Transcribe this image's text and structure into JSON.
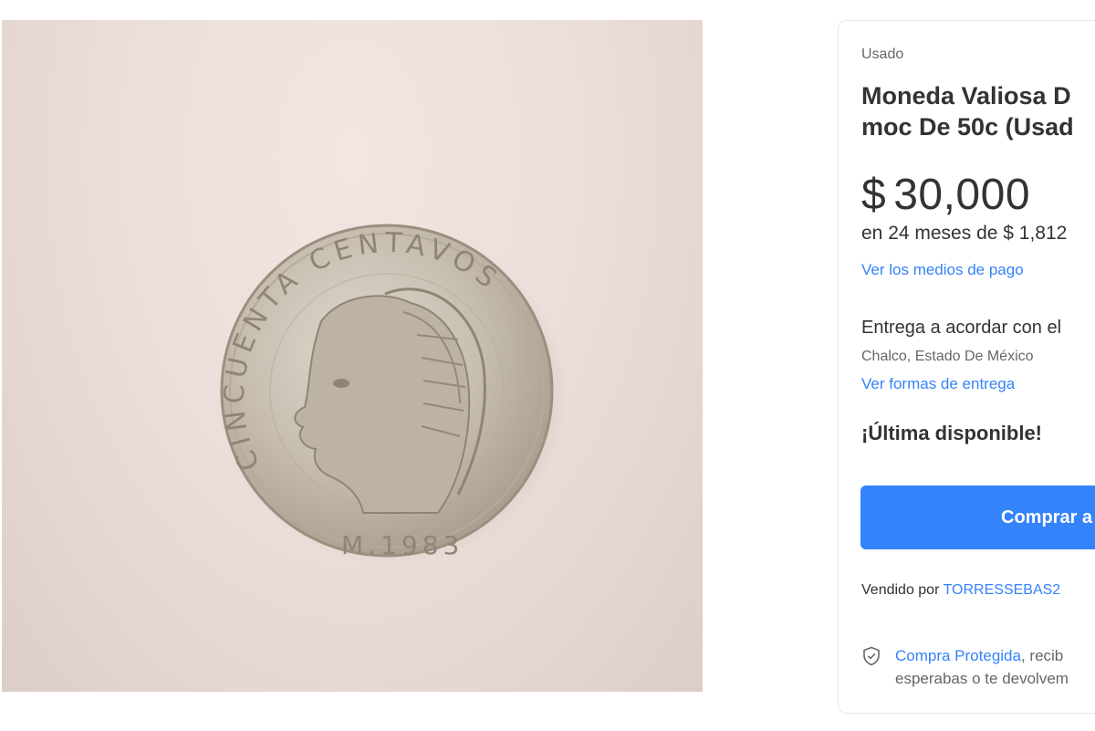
{
  "photo": {
    "alt": "coin-photo"
  },
  "product": {
    "condition": "Usado",
    "title": "Moneda Valiosa D\nmoc De 50c (Usad",
    "price_currency": "$",
    "price_value": "30,000",
    "installments_prefix": "en 24 meses de ",
    "installments_amount": "$ 1,812",
    "payment_link": "Ver los medios de pago",
    "delivery": "Entrega a acordar con el",
    "location": "Chalco, Estado De México",
    "delivery_link": "Ver formas de entrega",
    "stock": "¡Última disponible!",
    "buy_button": "Comprar a",
    "seller_prefix": "Vendido por ",
    "seller_name": "TORRESSEBAS2",
    "protection_link": "Compra Protegida",
    "protection_text_1": ", recib",
    "protection_text_2": "esperabas o te devolvem"
  },
  "colors": {
    "accent": "#3483fa",
    "text": "#333333",
    "muted": "#666666"
  },
  "icons": {
    "protection": "shield-check-icon"
  }
}
